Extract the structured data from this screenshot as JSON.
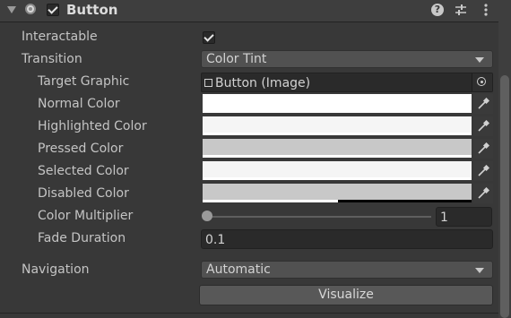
{
  "component": {
    "title": "Button",
    "enabled": true
  },
  "fields": {
    "interactable": {
      "label": "Interactable",
      "checked": true
    },
    "transition": {
      "label": "Transition",
      "value": "Color Tint"
    },
    "target_graphic": {
      "label": "Target Graphic",
      "value": "Button (Image)"
    },
    "normal_color": {
      "label": "Normal Color",
      "color": "#ffffff",
      "alpha": 1.0
    },
    "highlighted_color": {
      "label": "Highlighted Color",
      "color": "#f5f5f5",
      "alpha": 1.0
    },
    "pressed_color": {
      "label": "Pressed Color",
      "color": "#c8c8c8",
      "alpha": 1.0
    },
    "selected_color": {
      "label": "Selected Color",
      "color": "#f5f5f5",
      "alpha": 1.0
    },
    "disabled_color": {
      "label": "Disabled Color",
      "color": "#c8c8c8",
      "alpha": 0.5
    },
    "color_multiplier": {
      "label": "Color Multiplier",
      "value": "1",
      "slider_fraction": 0.0
    },
    "fade_duration": {
      "label": "Fade Duration",
      "value": "0.1"
    },
    "navigation": {
      "label": "Navigation",
      "value": "Automatic"
    }
  },
  "visualize_button": {
    "label": "Visualize"
  },
  "icons": {
    "foldout": "triangle-down-icon",
    "component": "circle-component-icon",
    "help": "help-icon",
    "presets": "sliders-icon",
    "menu": "kebab-menu-icon",
    "image": "image-icon",
    "object_picker": "target-icon",
    "eyedropper": "eyedropper-icon"
  },
  "colors": {
    "background": "#383838",
    "header": "#3e3e3e",
    "text": "#c4c4c4",
    "field": "#2a2a2a",
    "dropdown": "#515151"
  }
}
